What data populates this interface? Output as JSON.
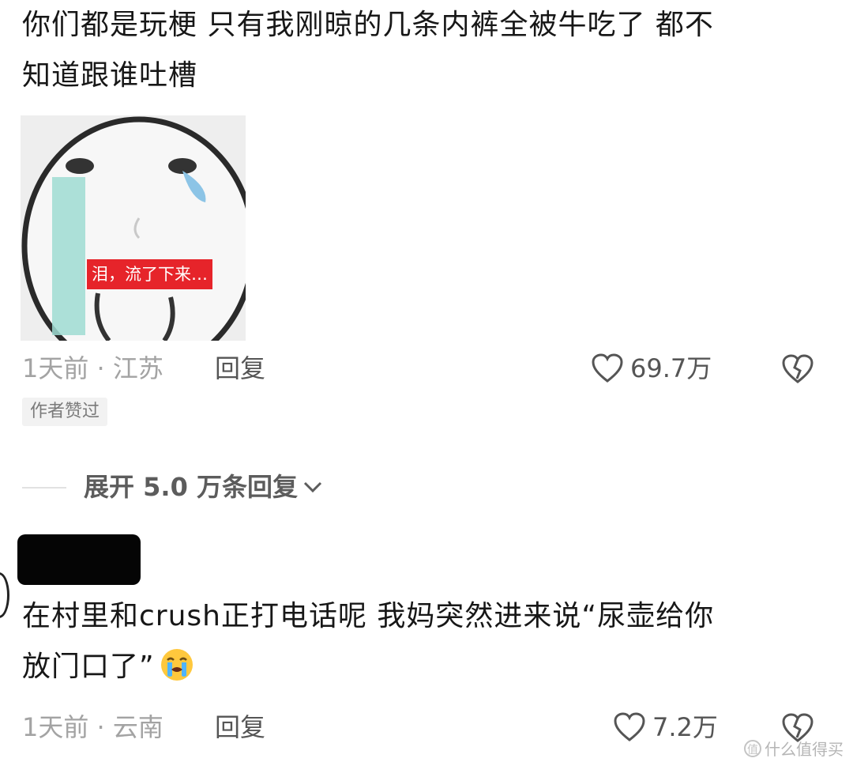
{
  "comment1": {
    "text_line1": "你们都是玩梗 只有我刚晾的几条内裤全被牛吃了 都不",
    "text_line2": "知道跟谁吐槽",
    "sticker_caption": "泪，流了下来…",
    "time_location": "1天前 · 江苏",
    "reply_label": "回复",
    "likes": "69.7万",
    "author_liked_badge": "作者赞过",
    "expand_replies": "展开 5.0 万条回复"
  },
  "comment2": {
    "text_line1": "在村里和crush正打电话呢 我妈突然进来说“尿壶给你",
    "text_line2": "放门口了”",
    "time_location": "1天前 · 云南",
    "reply_label": "回复",
    "likes": "7.2万"
  },
  "watermark": "什么值得买",
  "icons": {
    "like": "heart-outline-icon",
    "dislike": "broken-heart-icon",
    "expand": "chevron-down-icon",
    "emoji": "loudly-crying-face-icon"
  },
  "colors": {
    "text": "#171717",
    "meta": "#a3a3a3",
    "caption_bg": "#e6242a"
  }
}
